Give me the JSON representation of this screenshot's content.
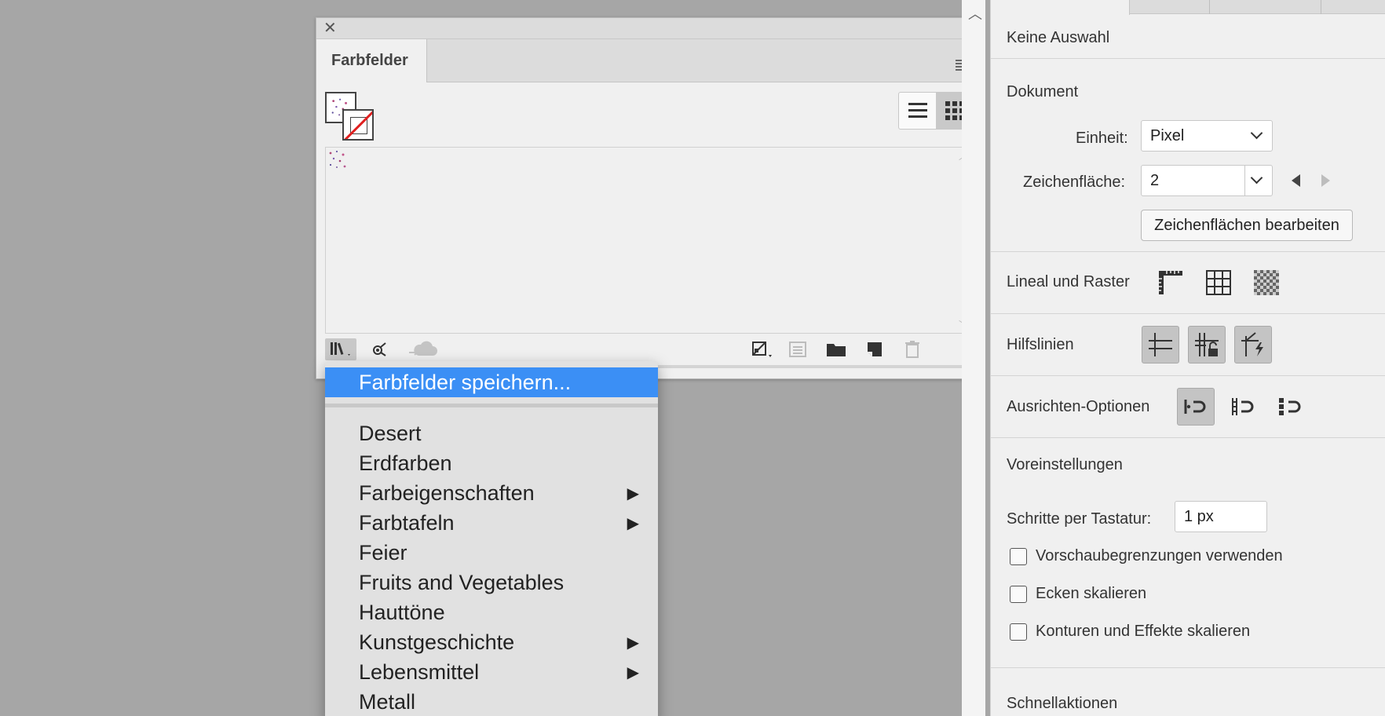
{
  "swatches_panel": {
    "tab_label": "Farbfelder",
    "close_glyph": "✕",
    "collapse_glyph": "‹‹"
  },
  "library_menu": {
    "highlighted": "Farbfelder speichern...",
    "items": [
      {
        "label": "Desert",
        "submenu": false
      },
      {
        "label": "Erdfarben",
        "submenu": false
      },
      {
        "label": "Farbeigenschaften",
        "submenu": true
      },
      {
        "label": "Farbtafeln",
        "submenu": true
      },
      {
        "label": "Feier",
        "submenu": false
      },
      {
        "label": "Fruits and Vegetables",
        "submenu": false
      },
      {
        "label": "Hauttöne",
        "submenu": false
      },
      {
        "label": "Kunstgeschichte",
        "submenu": true
      },
      {
        "label": "Lebensmittel",
        "submenu": true
      },
      {
        "label": "Metall",
        "submenu": false
      }
    ],
    "submenu_arrow": "▶",
    "highlight_color": "#3b8ff5"
  },
  "properties": {
    "selection": "Keine Auswahl",
    "document": {
      "title": "Dokument",
      "unit_label": "Einheit:",
      "unit_value": "Pixel",
      "artboard_label": "Zeichenfläche:",
      "artboard_value": "2",
      "edit_artboards": "Zeichenflächen bearbeiten"
    },
    "ruler_grid": {
      "label": "Lineal und Raster"
    },
    "guides": {
      "label": "Hilfslinien"
    },
    "align": {
      "label": "Ausrichten-Optionen"
    },
    "prefs": {
      "title": "Voreinstellungen",
      "keyboard_label": "Schritte per Tastatur:",
      "keyboard_value": "1 px",
      "checkboxes": [
        "Vorschaubegrenzungen verwenden",
        "Ecken skalieren",
        "Konturen und Effekte skalieren"
      ]
    },
    "quick_actions": "Schnellaktionen"
  }
}
